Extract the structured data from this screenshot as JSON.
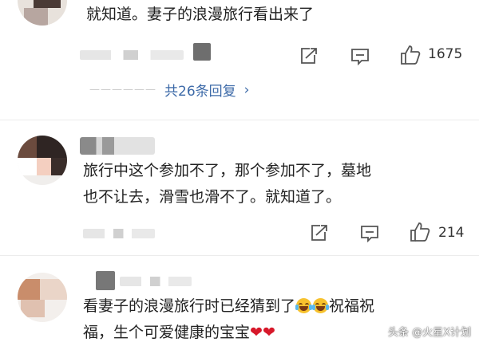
{
  "comments": [
    {
      "text": "就知道。妻子的浪漫旅行看出来了",
      "like_count": "1675",
      "reply_link": {
        "dashes": "——————",
        "label": "共26条回复",
        "chevron": "›"
      }
    },
    {
      "text": "旅行中这个参加不了，那个参加不了，墓地\n也不让去，滑雪也滑不了。就知道了。",
      "like_count": "214"
    },
    {
      "text_part1": "看妻子的浪漫旅行时已经猜到了",
      "text_part2": "祝福祝",
      "text_part3": "福，生个可爱健康的宝宝"
    }
  ],
  "icons": {
    "share": "share-icon",
    "comment": "comment-icon",
    "like": "thumbs-up-icon",
    "emoji": "laugh-cry-emoji",
    "heart": "red-heart-emoji"
  },
  "colors": {
    "link": "#3d6aa8",
    "heart": "#d7182a"
  },
  "watermark": "头条 @火星X计划"
}
